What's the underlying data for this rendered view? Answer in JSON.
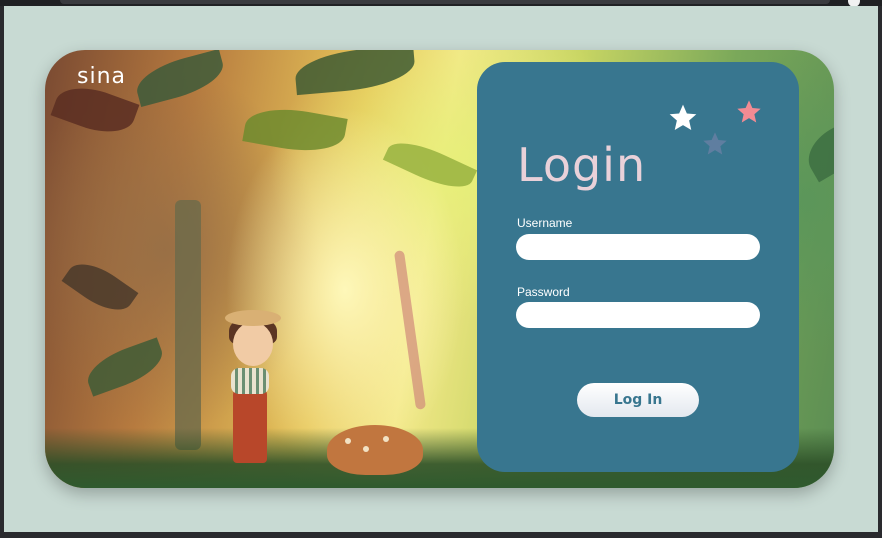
{
  "app": {
    "brand": "sina"
  },
  "login": {
    "title": "Login",
    "username_label": "Username",
    "username_value": "",
    "password_label": "Password",
    "password_value": "",
    "submit_label": "Log In"
  },
  "colors": {
    "page_background": "#c8dad3",
    "panel": "#38768f",
    "title": "#e9d1d9",
    "star_white": "#ffffff",
    "star_pink": "#f28b93",
    "star_slate": "#5f7ea0"
  },
  "decorations": {
    "stars": [
      "white-star-icon",
      "pink-star-icon",
      "slate-star-icon"
    ],
    "illustration": "forest-illustration"
  }
}
